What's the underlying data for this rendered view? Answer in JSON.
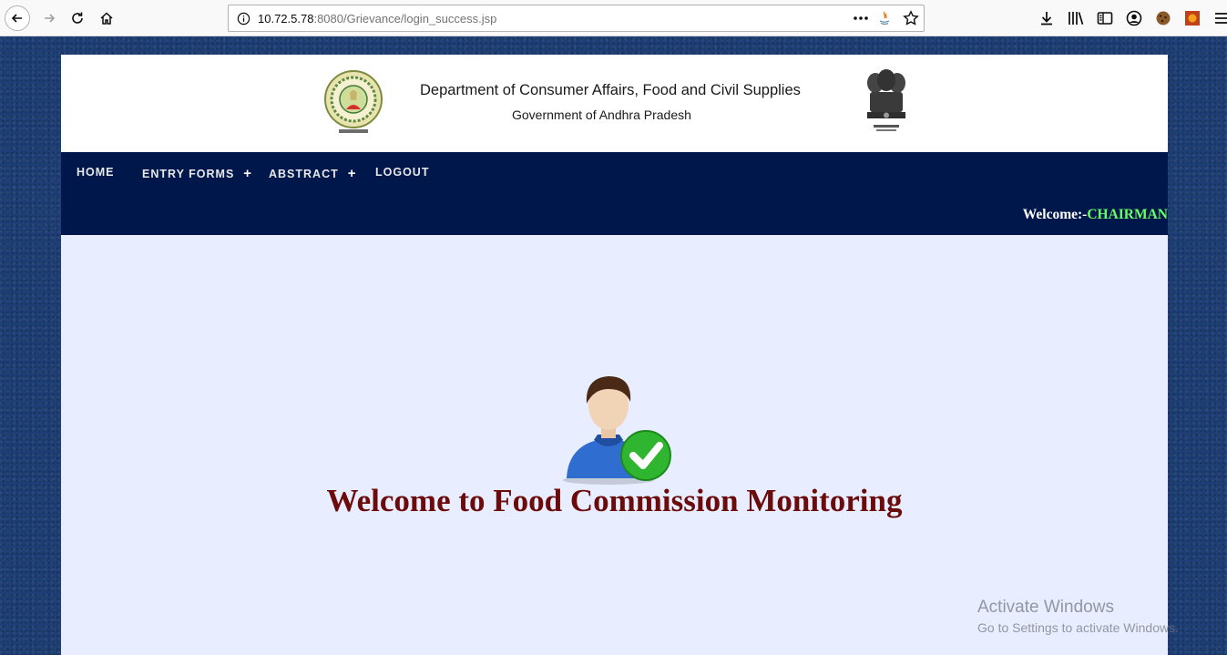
{
  "browser": {
    "url_host": "10.72.5.78",
    "url_rest": ":8080/Grievance/login_success.jsp"
  },
  "header": {
    "title": "Department of Consumer Affairs, Food and Civil Supplies",
    "subtitle": "Government of Andhra Pradesh"
  },
  "menu": {
    "items": [
      {
        "label": "HOME",
        "has_submenu": false
      },
      {
        "label": "ENTRY FORMS",
        "has_submenu": true
      },
      {
        "label": "ABSTRACT",
        "has_submenu": true
      },
      {
        "label": "LOGOUT",
        "has_submenu": false
      }
    ],
    "welcome_prefix": "Welcome:-",
    "welcome_user": "CHAIRMAN"
  },
  "main": {
    "title": "Welcome to Food Commission Monitoring"
  },
  "watermark": {
    "title": "Activate Windows",
    "subtitle": "Go to Settings to activate Windows."
  },
  "colors": {
    "menubar": "#00174b",
    "page_bg": "#e8eeff",
    "title": "#6b0b0b",
    "welcome_user": "#66ff66"
  }
}
